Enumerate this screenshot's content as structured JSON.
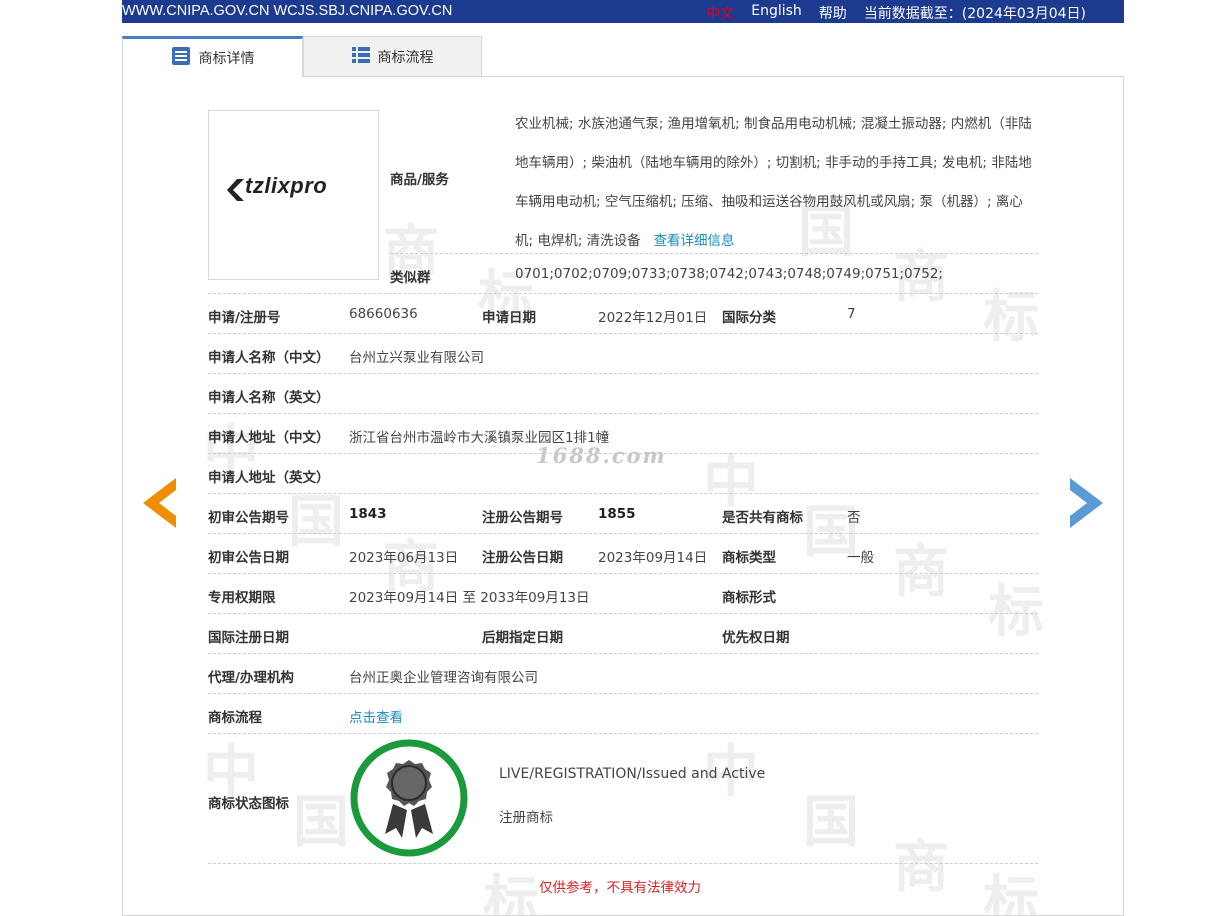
{
  "topbar": {
    "site": "WWW.CNIPA.GOV.CN WCJS.SBJ.CNIPA.GOV.CN",
    "lang_cn": "中文",
    "lang_en": "English",
    "help": "帮助",
    "data_date": "当前数据截至：(2024年03月04日)"
  },
  "tabs": [
    {
      "label": "商标详情",
      "active": true
    },
    {
      "label": "商标流程",
      "active": false
    }
  ],
  "logo": {
    "text": "tzlixpro"
  },
  "goods": {
    "label": "商品/服务",
    "text": "农业机械; 水族池通气泵; 渔用增氧机; 制食品用电动机械; 混凝土振动器; 内燃机（非陆地车辆用）; 柴油机（陆地车辆用的除外）; 切割机; 非手动的手持工具; 发电机; 非陆地车辆用电动机; 空气压缩机; 压缩、抽吸和运送谷物用鼓风机或风扇; 泵（机器）; 离心机; 电焊机; 清洗设备",
    "link": "查看详细信息"
  },
  "similar_group": {
    "label": "类似群",
    "value": "0701;0702;0709;0733;0738;0742;0743;0748;0749;0751;0752;"
  },
  "fields": {
    "reg_no_label": "申请/注册号",
    "reg_no": "68660636",
    "apply_date_label": "申请日期",
    "apply_date": "2022年12月01日",
    "intl_class_label": "国际分类",
    "intl_class": "7",
    "applicant_cn_label": "申请人名称（中文）",
    "applicant_cn": "台州立兴泵业有限公司",
    "applicant_en_label": "申请人名称（英文）",
    "address_cn_label": "申请人地址（中文）",
    "address_cn": "浙江省台州市温岭市大溪镇泵业园区1排1幢",
    "address_en_label": "申请人地址（英文）",
    "prelim_no_label": "初审公告期号",
    "prelim_no": "1843",
    "reg_pub_no_label": "注册公告期号",
    "reg_pub_no": "1855",
    "shared_label": "是否共有商标",
    "shared": "否",
    "prelim_date_label": "初审公告日期",
    "prelim_date": "2023年06月13日",
    "reg_pub_date_label": "注册公告日期",
    "reg_pub_date": "2023年09月14日",
    "mark_type_label": "商标类型",
    "mark_type": "一般",
    "exclusive_label": "专用权期限",
    "exclusive": "2023年09月14日 至 2033年09月13日",
    "mark_form_label": "商标形式",
    "intl_reg_date_label": "国际注册日期",
    "later_date_label": "后期指定日期",
    "priority_label": "优先权日期",
    "agent_label": "代理/办理机构",
    "agent": "台州正奥企业管理咨询有限公司",
    "flow_label": "商标流程",
    "flow_link": "点击查看",
    "status_label": "商标状态图标",
    "status_en": "LIVE/REGISTRATION/Issued and Active",
    "status_cn": "注册商标"
  },
  "overlay_watermark": "1688.com",
  "notice": "仅供参考，不具有法律效力",
  "colors": {
    "topbar": "#1c3a8f",
    "prev_arrow": "#f08c00",
    "next_arrow": "#5b9bd5",
    "status_ring": "#1a9a3a",
    "notice": "#e02020",
    "link": "#1a8dbc"
  }
}
